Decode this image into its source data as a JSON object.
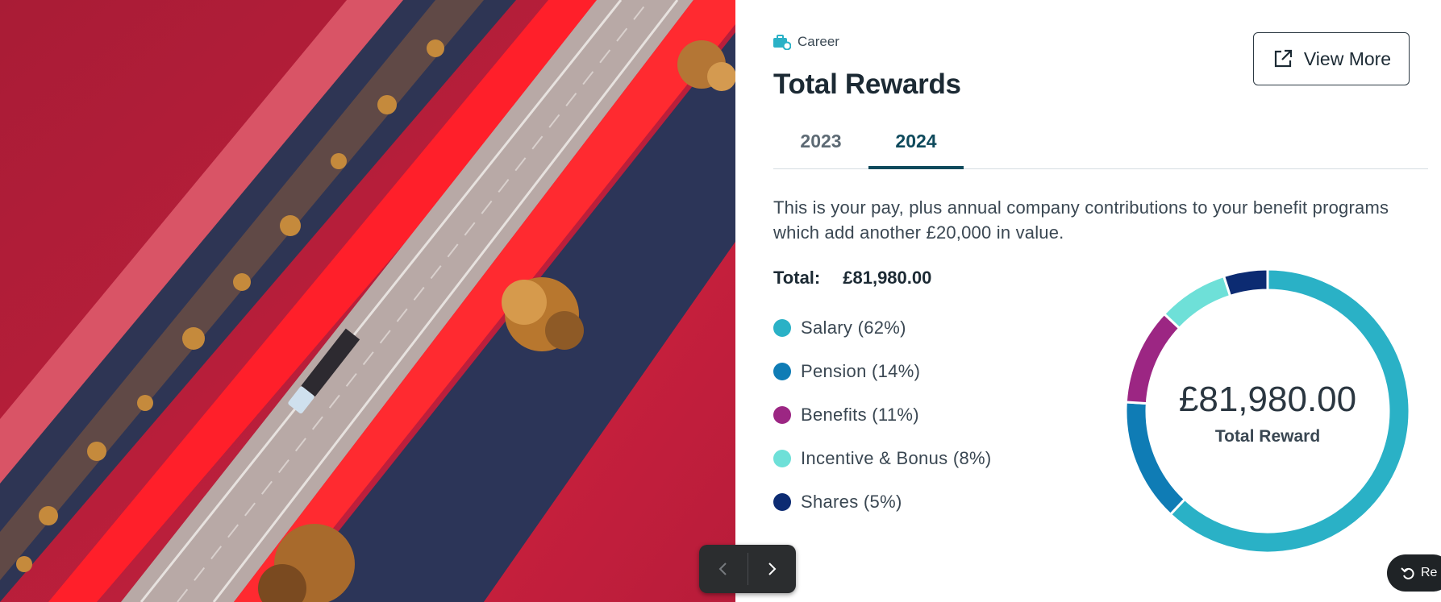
{
  "card": {
    "eyebrow": "Career",
    "title": "Total Rewards",
    "view_more_label": "View More",
    "tabs": [
      {
        "label": "2023",
        "active": false
      },
      {
        "label": "2024",
        "active": true
      }
    ],
    "description": "This is your pay, plus annual company contributions to your benefit programs which add another £20,000 in value.",
    "total_label": "Total:",
    "total_value": "£81,980.00",
    "legend": [
      {
        "label": "Salary (62%)",
        "color": "#2ab1c6"
      },
      {
        "label": "Pension (14%)",
        "color": "#0f7cb5"
      },
      {
        "label": "Benefits (11%)",
        "color": "#9c2683"
      },
      {
        "label": "Incentive & Bonus (8%)",
        "color": "#6ee0d8"
      },
      {
        "label": "Shares (5%)",
        "color": "#0c2b72"
      }
    ],
    "donut_center_value": "£81,980.00",
    "donut_center_label": "Total Reward"
  },
  "chart_data": {
    "type": "pie",
    "categories": [
      "Salary",
      "Pension",
      "Benefits",
      "Incentive & Bonus",
      "Shares"
    ],
    "values": [
      62,
      14,
      11,
      8,
      5
    ],
    "colors": [
      "#2ab1c6",
      "#0f7cb5",
      "#9c2683",
      "#6ee0d8",
      "#0c2b72"
    ]
  },
  "overlay": {
    "prev_icon": "chevron-left-icon",
    "next_icon": "chevron-right-icon",
    "pill_label": "Re",
    "pill_icon": "undo-icon"
  }
}
